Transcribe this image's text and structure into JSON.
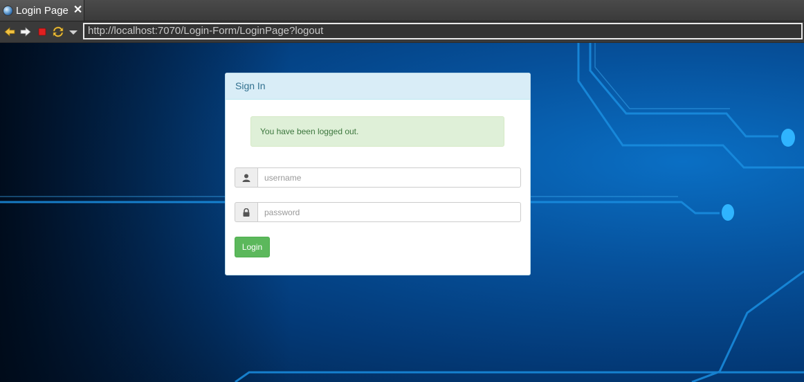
{
  "browser": {
    "tab": {
      "title": "Login Page",
      "close_label": "✕",
      "icon": "globe-icon"
    },
    "toolbar": {
      "buttons": [
        "back-arrow-icon",
        "forward-arrow-icon",
        "stop-icon",
        "refresh-icon",
        "dropdown-arrow-icon"
      ],
      "url": "http://localhost:7070/Login-Form/LoginPage?logout"
    }
  },
  "login_panel": {
    "heading": "Sign In",
    "alert": "You have been logged out.",
    "username": {
      "placeholder": "username",
      "value": "",
      "icon": "user-icon"
    },
    "password": {
      "placeholder": "password",
      "value": "",
      "icon": "lock-icon"
    },
    "submit_label": "Login"
  },
  "colors": {
    "heading_bg": "#d9edf7",
    "heading_text": "#31708f",
    "alert_bg": "#dff0d8",
    "alert_text": "#3c763d",
    "button_bg": "#5cb85c",
    "background_blue": "#06509a"
  }
}
